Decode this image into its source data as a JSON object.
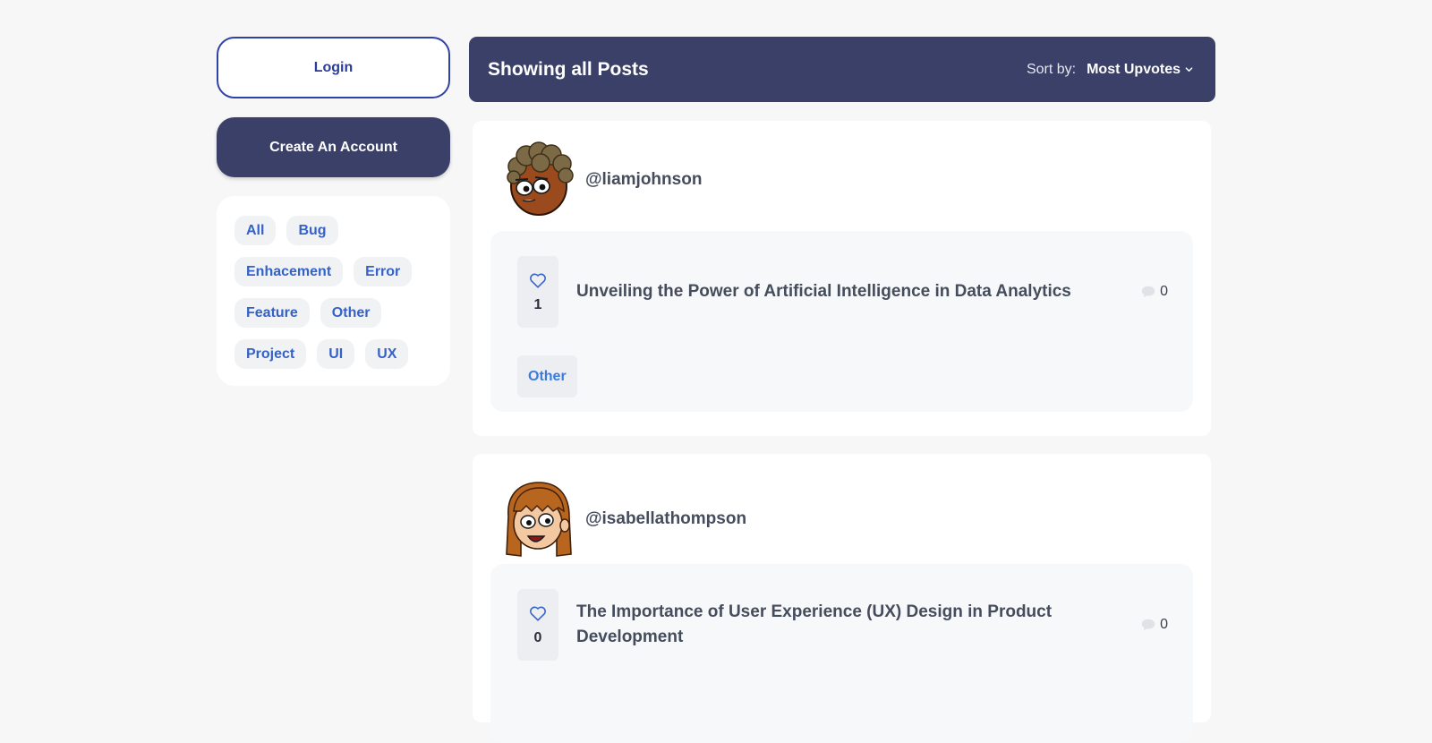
{
  "sidebar": {
    "login_label": "Login",
    "create_account_label": "Create An Account",
    "tags": [
      "All",
      "Bug",
      "Enhacement",
      "Error",
      "Feature",
      "Other",
      "Project",
      "UI",
      "UX"
    ]
  },
  "header": {
    "title": "Showing all Posts",
    "sort_label": "Sort by:",
    "sort_value": "Most Upvotes"
  },
  "posts": [
    {
      "username": "@liamjohnson",
      "title": "Unveiling the Power of Artificial Intelligence in Data Analytics",
      "upvotes": "1",
      "comments": "0",
      "tag": "Other"
    },
    {
      "username": "@isabellathompson",
      "title": "The Importance of User Experience (UX) Design in Product Development",
      "upvotes": "0",
      "comments": "0"
    }
  ],
  "colors": {
    "primary": "#3a4068",
    "accent_blue": "#3562c9",
    "login_border": "#2f43a6",
    "background": "#f7f7f8"
  }
}
